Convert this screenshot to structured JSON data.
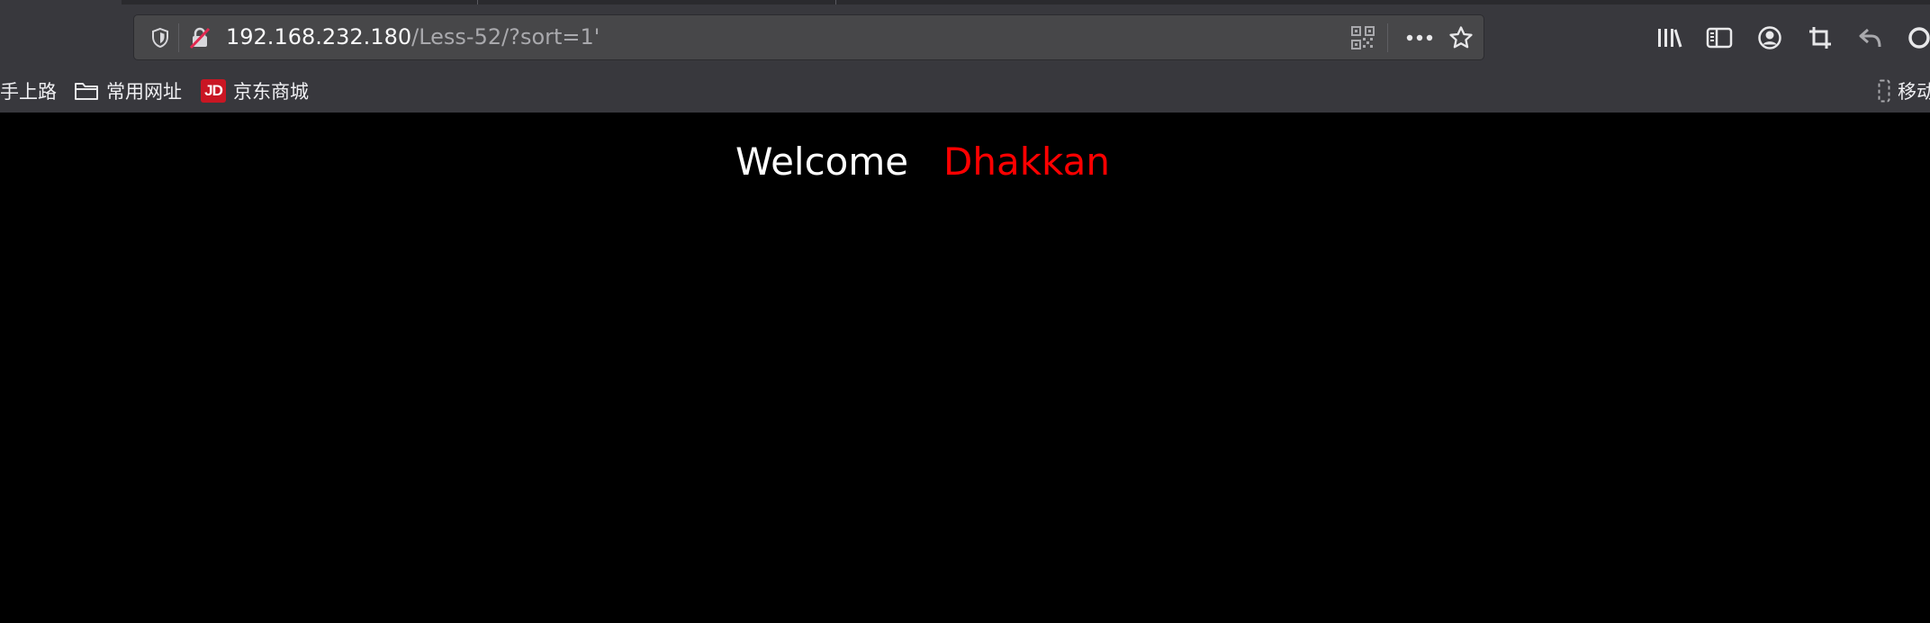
{
  "browser": {
    "url_host": "192.168.232.180",
    "url_path": "/Less-52/?sort=1'"
  },
  "bookmarks": [
    {
      "label": "手上路",
      "icon": "none"
    },
    {
      "label": "常用网址",
      "icon": "folder-icon"
    },
    {
      "label": "京东商城",
      "icon": "jd-logo",
      "badge": "JD"
    },
    {
      "label": "移动",
      "icon": "mobile-icon"
    }
  ],
  "page": {
    "welcome_text": "Welcome",
    "user_name": "Dhakkan",
    "name_color": "#ff0000"
  },
  "toolbar_icons": [
    "tracking-shield-icon",
    "insecure-lock-icon",
    "qr-code-icon",
    "more-actions-icon",
    "bookmark-star-icon",
    "library-icon",
    "sidebar-icon",
    "account-icon",
    "screenshot-crop-icon",
    "undo-arrow-icon",
    "circle-icon"
  ]
}
